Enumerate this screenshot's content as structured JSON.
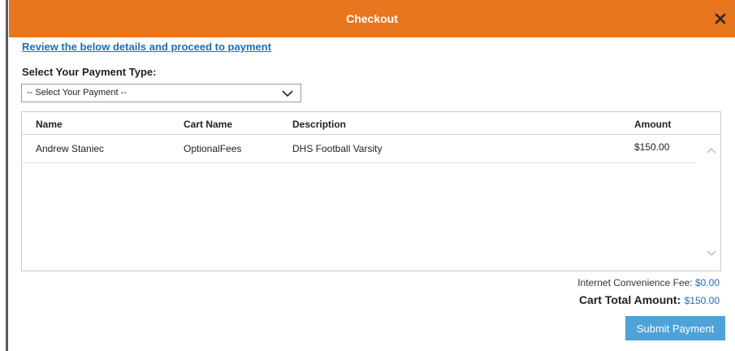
{
  "dialog": {
    "title": "Checkout",
    "close_icon": "close-icon"
  },
  "review_link": "Review the below details and proceed to payment",
  "payment": {
    "label": "Select Your Payment Type:",
    "selected": "-- Select Your Payment --",
    "icon": "chevron-down-icon"
  },
  "table": {
    "columns": [
      "Name",
      "Cart Name",
      "Description",
      "Amount"
    ],
    "rows": [
      {
        "name": "Andrew Staniec",
        "cart_name": "OptionalFees",
        "description": "DHS Football Varsity",
        "amount": "$150.00"
      }
    ]
  },
  "summary": {
    "fee_label": "Internet Convenience Fee:",
    "fee_value": "$0.00",
    "total_label": "Cart Total Amount:",
    "total_value": "$150.00"
  },
  "submit_label": "Submit Payment",
  "colors": {
    "header": "#e8761e",
    "link": "#1a6fb8",
    "button": "#4fa2d8"
  }
}
